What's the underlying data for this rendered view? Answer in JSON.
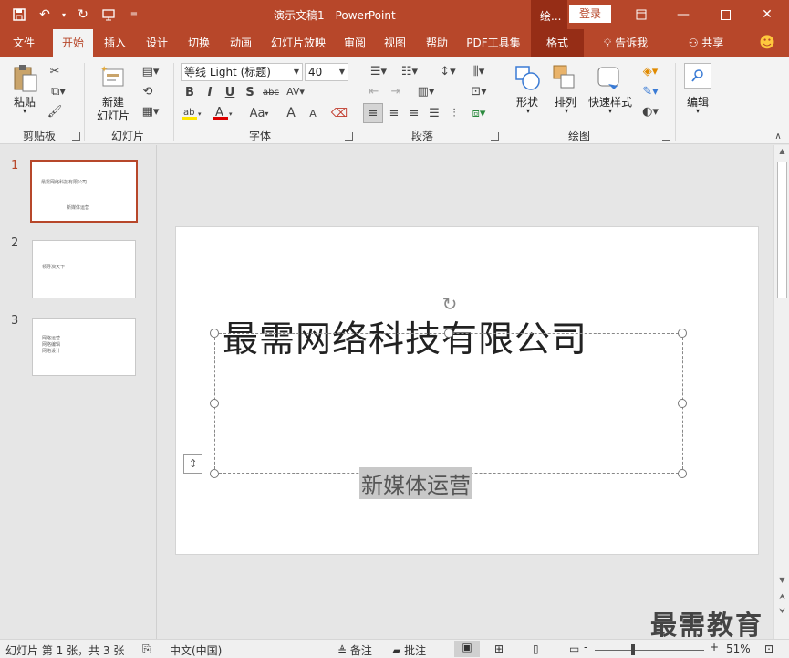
{
  "window": {
    "title": "演示文稿1  -  PowerPoint",
    "context_tab_short": "绘...",
    "login_label": "登录"
  },
  "tabs": [
    {
      "label": "文件"
    },
    {
      "label": "开始"
    },
    {
      "label": "插入"
    },
    {
      "label": "设计"
    },
    {
      "label": "切换"
    },
    {
      "label": "动画"
    },
    {
      "label": "幻灯片放映"
    },
    {
      "label": "审阅"
    },
    {
      "label": "视图"
    },
    {
      "label": "帮助"
    },
    {
      "label": "PDF工具集"
    },
    {
      "label": "格式"
    },
    {
      "label": "告诉我"
    },
    {
      "label": "共享"
    }
  ],
  "ribbon": {
    "clipboard": {
      "paste": "粘贴",
      "group": "剪贴板"
    },
    "slides": {
      "new_slide_line1": "新建",
      "new_slide_line2": "幻灯片",
      "group": "幻灯片"
    },
    "font": {
      "name": "等线 Light (标题)",
      "size": "40",
      "group": "字体",
      "bold": "B",
      "italic": "I",
      "underline": "U",
      "shadow": "S",
      "strike": "abc",
      "case": "Aa",
      "grow": "A",
      "shrink": "A"
    },
    "paragraph": {
      "group": "段落"
    },
    "drawing": {
      "shapes": "形状",
      "arrange": "排列",
      "quick_styles": "快速样式",
      "group": "绘图"
    },
    "editing": {
      "label": "编辑"
    }
  },
  "thumbnails": [
    {
      "number": "1",
      "lines": [
        "最需网络科技有限公司",
        "新媒体运营"
      ]
    },
    {
      "number": "2",
      "lines": [
        "领导演天下"
      ]
    },
    {
      "number": "3",
      "lines": [
        "网络运营",
        "网络编辑",
        "网络设计"
      ]
    }
  ],
  "slide": {
    "title": "最需网络科技有限公司",
    "subtitle": "新媒体运营"
  },
  "status": {
    "slide_info": "幻灯片 第 1 张，共 3 张",
    "language": "中文(中国)",
    "notes": "备注",
    "comments": "批注",
    "zoom": "51%",
    "zoom_minus": "-",
    "zoom_plus": "+"
  },
  "watermark": "最需教育"
}
